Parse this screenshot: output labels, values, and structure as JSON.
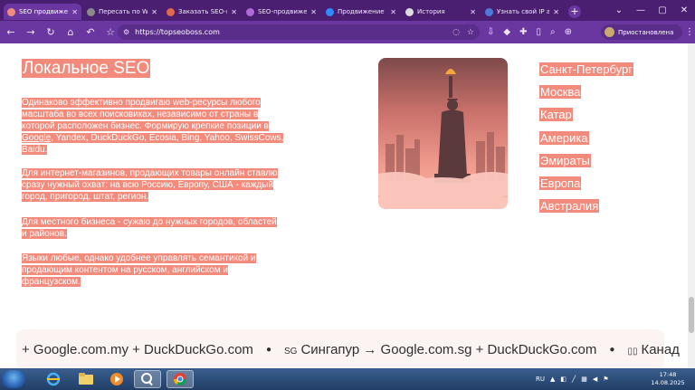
{
  "browser": {
    "tabs": [
      {
        "title": "SEO продвиже...",
        "active": true,
        "favicon_color": "#f28b7c"
      },
      {
        "title": "Пересать по W",
        "active": false,
        "favicon_color": "#8a8a8a"
      },
      {
        "title": "Заказать SEO-пр",
        "active": false,
        "favicon_color": "#e06a4a"
      },
      {
        "title": "SEO-продвижен",
        "active": false,
        "favicon_color": "#b06ad8"
      },
      {
        "title": "Продвижение с",
        "active": false,
        "favicon_color": "#2f8cff"
      },
      {
        "title": "История",
        "active": false,
        "favicon_color": "#dcdcdc"
      },
      {
        "title": "Узнать свой IP а",
        "active": false,
        "favicon_color": "#4a7bd8"
      }
    ],
    "url": "https://topseoboss.com",
    "profile_label": "Приостановлена",
    "accent_color": "#6a37a0"
  },
  "content": {
    "title": "Локальное SEO",
    "para1_a": "Одинаково эффективно продвигаю web-ресурсы любого масштаба во всех поисковиках, независимо от страны в которой расположен бизнес. Формирую крепкие позиции в ",
    "para1_link": "Google",
    "para1_b": ", Yandex, DuckDuckGo, Ecosia, Bing, Yahoo, SwissCows, Baidu.",
    "para2": "Для интернет-магазинов, продающих товары онлайн ставлю сразу нужный охват: на всю Россию, Европу, США - каждый город, пригород, штат, регион.",
    "para3": "Для местного бизнеса - сужаю до нужных городов, областей и районов.",
    "para4": "Языки любые, однако удобнее управлять семантикой и продающим контентом на русском, английском и французском.",
    "highlight_color": "#f28b7c",
    "cities": [
      "Санкт-Петербург",
      "Москва",
      "Катар",
      "Америка",
      "Эмираты",
      "Европа",
      "Австралия"
    ]
  },
  "marquee": {
    "seg1": "+ Google.com.my + DuckDuckGo.com",
    "cc2": "SG",
    "seg2": "Сингапур → Google.com.sg + DuckDuckGo.com",
    "seg3": "Канад"
  },
  "taskbar": {
    "lang": "RU",
    "time": "17:48",
    "date": "14.08.2025"
  }
}
